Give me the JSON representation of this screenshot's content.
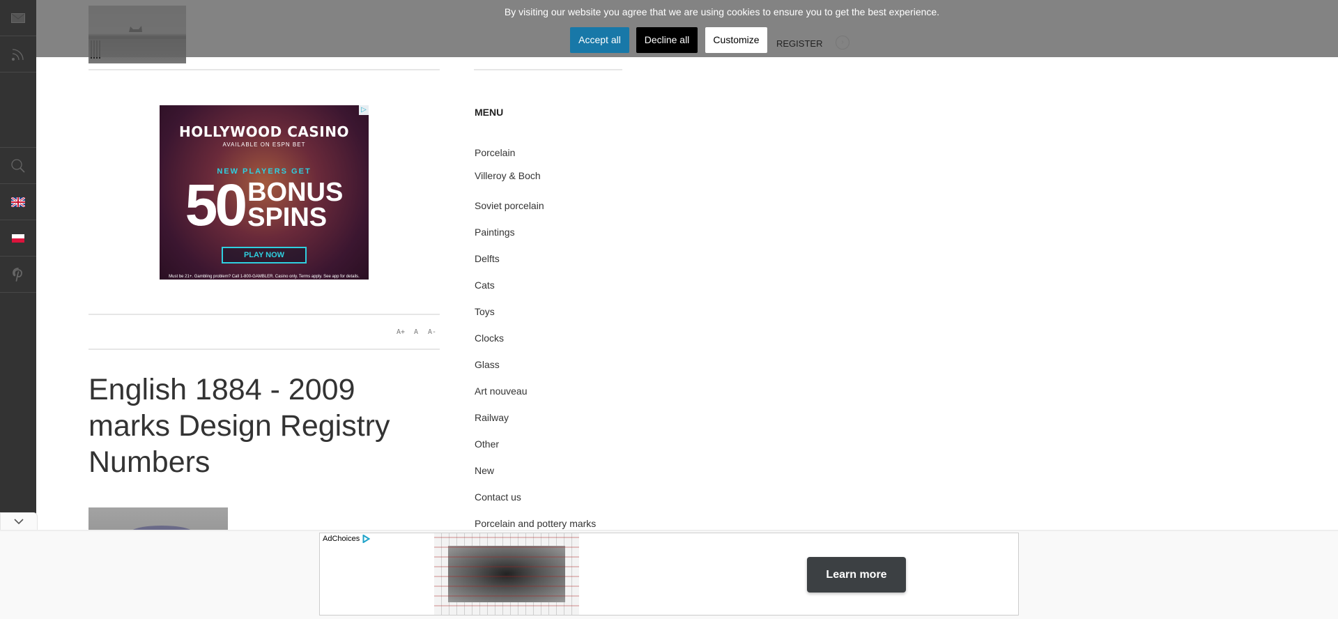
{
  "cookie_banner": {
    "message": "By visiting our website you agree that we are using cookies to ensure you to get the best experience.",
    "accept_label": "Accept all",
    "decline_label": "Decline all",
    "customize_label": "Customize"
  },
  "header": {
    "register_label": "REGISTER",
    "register_arrow": "›"
  },
  "sidebar": {
    "icons": [
      "mail-icon",
      "rss-icon",
      "search-icon",
      "flag-uk-icon",
      "flag-pl-icon",
      "pinterest-icon"
    ]
  },
  "side_ad": {
    "brand": "HOLLYWOOD CASINO",
    "sub": "AVAILABLE ON ESPN BET",
    "headline_small": "NEW PLAYERS GET",
    "big_number": "50",
    "big_line1": "BONUS",
    "big_line2": "SPINS",
    "cta": "PLAY NOW",
    "fine_print": "Must be 21+. Gambling problem? Call 1-800-GAMBLER. Casino only. Terms apply. See app for details.",
    "badge": "▷"
  },
  "text_size": {
    "increase": "A+",
    "normal": "A",
    "decrease": "A-"
  },
  "article": {
    "title": "English 1884 - 2009 marks Design Registry Numbers"
  },
  "menu": {
    "title": "MENU",
    "items": [
      "Porcelain",
      "Villeroy & Boch",
      "Soviet porcelain",
      "Paintings",
      "Delfts",
      "Cats",
      "Toys",
      "Clocks",
      "Glass",
      "Art nouveau",
      "Railway",
      "Other",
      "New",
      "Contact us",
      "Porcelain and pottery marks"
    ]
  },
  "bottom_ad": {
    "adchoices_label": "AdChoices",
    "cta": "Learn more"
  },
  "colors": {
    "accept": "#1878a8",
    "decline": "#000000",
    "sidebar": "#333333",
    "learn_more": "#3c4043"
  }
}
